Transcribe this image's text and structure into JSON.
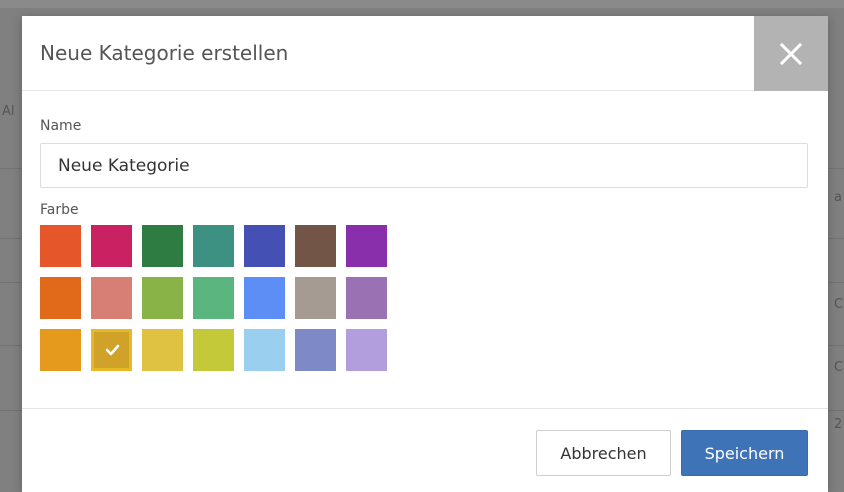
{
  "dialog": {
    "title": "Neue Kategorie erstellen",
    "close_icon": "close-icon"
  },
  "name_field": {
    "label": "Name",
    "value": "Neue Kategorie"
  },
  "color_field": {
    "label": "Farbe",
    "selected_index": 15,
    "swatches": [
      "#e5562a",
      "#c92161",
      "#2f7c43",
      "#3c9183",
      "#4450b3",
      "#735547",
      "#8a2fab",
      "#e06a1a",
      "#d77f75",
      "#8ab347",
      "#5bb57f",
      "#5c8ef5",
      "#a69b92",
      "#9a71b3",
      "#e69a1d",
      "#d0a22a",
      "#e0c242",
      "#c4c93a",
      "#9bcfef",
      "#7e8ac8",
      "#b39edd"
    ],
    "selected_icon": "checkmark-icon"
  },
  "footer": {
    "cancel_label": "Abbrechen",
    "save_label": "Speichern"
  },
  "background": {
    "fragments": [
      "Al",
      "a",
      "C",
      "2",
      "C"
    ]
  }
}
